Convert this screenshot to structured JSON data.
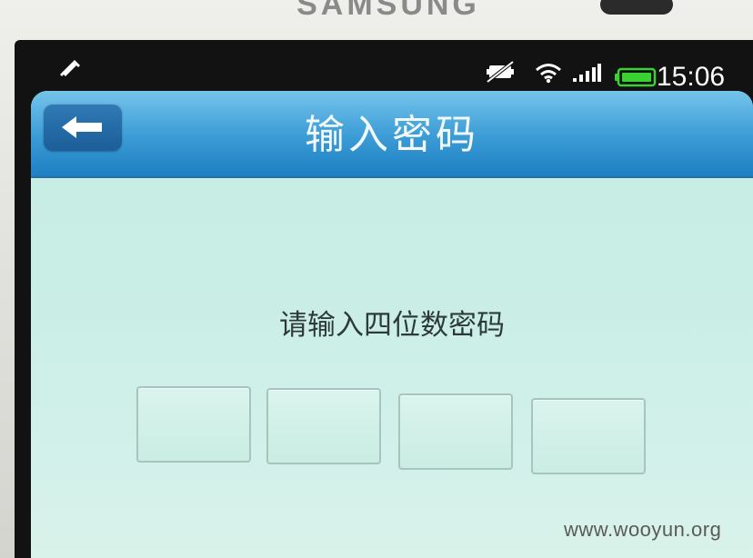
{
  "device": {
    "brand": "SAMSUNG"
  },
  "status_bar": {
    "time": "15:06",
    "icons": [
      "notification-icon",
      "mute-icon",
      "wifi-icon",
      "signal-icon",
      "battery-icon"
    ],
    "battery_color": "#39d232"
  },
  "header": {
    "back_icon": "back-arrow-icon",
    "title": "输入密码",
    "bg_color": "#3a9bd5"
  },
  "main": {
    "prompt": "请输入四位数密码",
    "pin_inputs": [
      {
        "value": ""
      },
      {
        "value": ""
      },
      {
        "value": ""
      },
      {
        "value": ""
      }
    ]
  },
  "watermark": "www.wooyun.org"
}
